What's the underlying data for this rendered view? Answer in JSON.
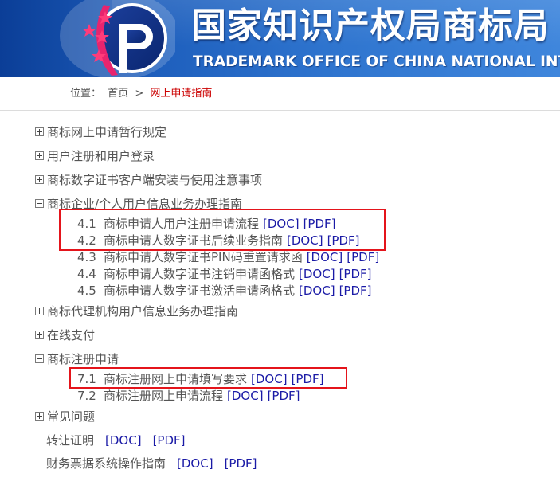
{
  "header": {
    "title": "国家知识产权局商标局",
    "subtitle": "TRADEMARK OFFICE OF CHINA NATIONAL INTELLECTUAL",
    "colors": {
      "banner_dark": "#0b3e97",
      "banner_light": "#3f86dc",
      "logo_pink": "#e8246e",
      "logo_blue": "#10308a"
    }
  },
  "breadcrumb": {
    "label": "位置：",
    "home": "首页",
    "separator": ">",
    "current": "网上申请指南"
  },
  "tree": [
    {
      "title": "商标网上申请暂行规定",
      "state": "collapsed"
    },
    {
      "title": "用户注册和用户登录",
      "state": "collapsed"
    },
    {
      "title": "商标数字证书客户端安装与使用注意事项",
      "state": "collapsed"
    },
    {
      "title": "商标企业/个人用户信息业务办理指南",
      "state": "expanded",
      "children": [
        {
          "num": "4.1",
          "text": "商标申请人用户注册申请流程",
          "doc": "[DOC]",
          "pdf": "[PDF]"
        },
        {
          "num": "4.2",
          "text": "商标申请人数字证书后续业务指南",
          "doc": "[DOC]",
          "pdf": "[PDF]"
        },
        {
          "num": "4.3",
          "text": "商标申请人数字证书PIN码重置请求函",
          "doc": "[DOC]",
          "pdf": "[PDF]"
        },
        {
          "num": "4.4",
          "text": "商标申请人数字证书注销申请函格式",
          "doc": "[DOC]",
          "pdf": "[PDF]"
        },
        {
          "num": "4.5",
          "text": "商标申请人数字证书激活申请函格式",
          "doc": "[DOC]",
          "pdf": "[PDF]"
        }
      ]
    },
    {
      "title": "商标代理机构用户信息业务办理指南",
      "state": "collapsed"
    },
    {
      "title": "在线支付",
      "state": "collapsed"
    },
    {
      "title": "商标注册申请",
      "state": "expanded",
      "children": [
        {
          "num": "7.1",
          "text": "商标注册网上申请填写要求",
          "doc": "[DOC]",
          "pdf": "[PDF]"
        },
        {
          "num": "7.2",
          "text": "商标注册网上申请流程",
          "doc": "[DOC]",
          "pdf": "[PDF]"
        }
      ]
    },
    {
      "title": "常见问题",
      "state": "collapsed"
    }
  ],
  "extra_items": [
    {
      "text": "转让证明",
      "doc": "[DOC]",
      "pdf": "[PDF]"
    },
    {
      "text": "财务票据系统操作指南",
      "doc": "[DOC]",
      "pdf": "[PDF]"
    }
  ],
  "annotations": {
    "highlight_color": "#e4141b"
  }
}
